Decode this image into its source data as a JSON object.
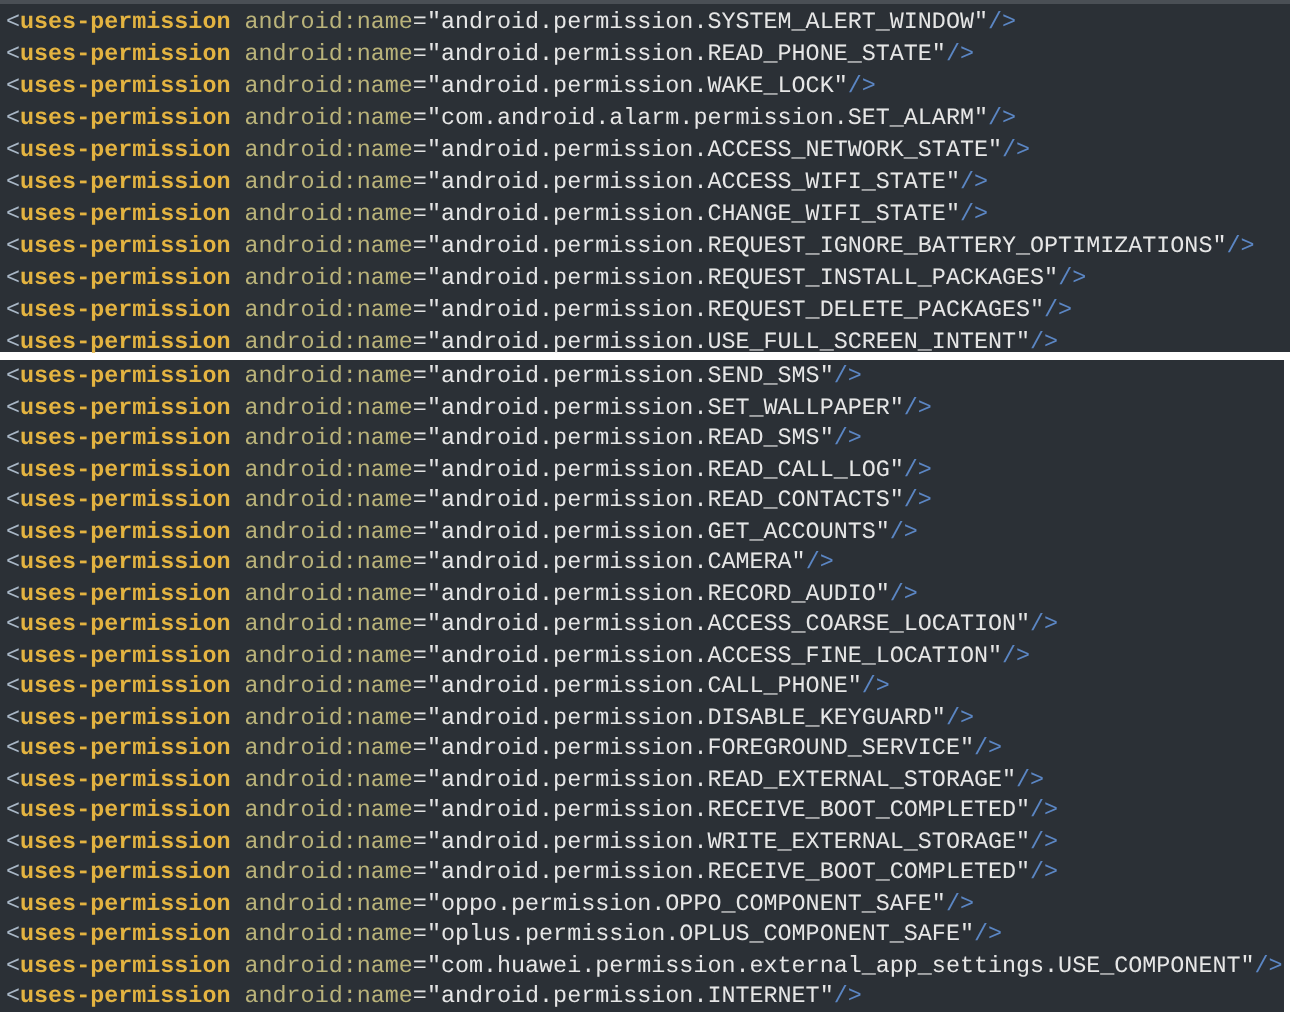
{
  "panels": [
    {
      "lines": [
        "<uses-permission android:name=\"android.permission.SYSTEM_ALERT_WINDOW\"/>",
        "<uses-permission android:name=\"android.permission.READ_PHONE_STATE\"/>",
        "<uses-permission android:name=\"android.permission.WAKE_LOCK\"/>",
        "<uses-permission android:name=\"com.android.alarm.permission.SET_ALARM\"/>",
        "<uses-permission android:name=\"android.permission.ACCESS_NETWORK_STATE\"/>",
        "<uses-permission android:name=\"android.permission.ACCESS_WIFI_STATE\"/>",
        "<uses-permission android:name=\"android.permission.CHANGE_WIFI_STATE\"/>",
        "<uses-permission android:name=\"android.permission.REQUEST_IGNORE_BATTERY_OPTIMIZATIONS\"/>",
        "<uses-permission android:name=\"android.permission.REQUEST_INSTALL_PACKAGES\"/>",
        "<uses-permission android:name=\"android.permission.REQUEST_DELETE_PACKAGES\"/>",
        "<uses-permission android:name=\"android.permission.USE_FULL_SCREEN_INTENT\"/>"
      ]
    },
    {
      "lines": [
        "<uses-permission android:name=\"android.permission.SEND_SMS\"/>",
        "<uses-permission android:name=\"android.permission.SET_WALLPAPER\"/>",
        "<uses-permission android:name=\"android.permission.READ_SMS\"/>",
        "<uses-permission android:name=\"android.permission.READ_CALL_LOG\"/>",
        "<uses-permission android:name=\"android.permission.READ_CONTACTS\"/>",
        "<uses-permission android:name=\"android.permission.GET_ACCOUNTS\"/>",
        "<uses-permission android:name=\"android.permission.CAMERA\"/>",
        "<uses-permission android:name=\"android.permission.RECORD_AUDIO\"/>",
        "<uses-permission android:name=\"android.permission.ACCESS_COARSE_LOCATION\"/>",
        "<uses-permission android:name=\"android.permission.ACCESS_FINE_LOCATION\"/>",
        "<uses-permission android:name=\"android.permission.CALL_PHONE\"/>",
        "<uses-permission android:name=\"android.permission.DISABLE_KEYGUARD\"/>",
        "<uses-permission android:name=\"android.permission.FOREGROUND_SERVICE\"/>",
        "<uses-permission android:name=\"android.permission.READ_EXTERNAL_STORAGE\"/>",
        "<uses-permission android:name=\"android.permission.RECEIVE_BOOT_COMPLETED\"/>",
        "<uses-permission android:name=\"android.permission.WRITE_EXTERNAL_STORAGE\"/>",
        "<uses-permission android:name=\"android.permission.RECEIVE_BOOT_COMPLETED\"/>",
        "<uses-permission android:name=\"oppo.permission.OPPO_COMPONENT_SAFE\"/>",
        "<uses-permission android:name=\"oplus.permission.OPLUS_COMPONENT_SAFE\"/>",
        "<uses-permission android:name=\"com.huawei.permission.external_app_settings.USE_COMPONENT\"/>",
        "<uses-permission android:name=\"android.permission.INTERNET\"/>"
      ]
    }
  ]
}
